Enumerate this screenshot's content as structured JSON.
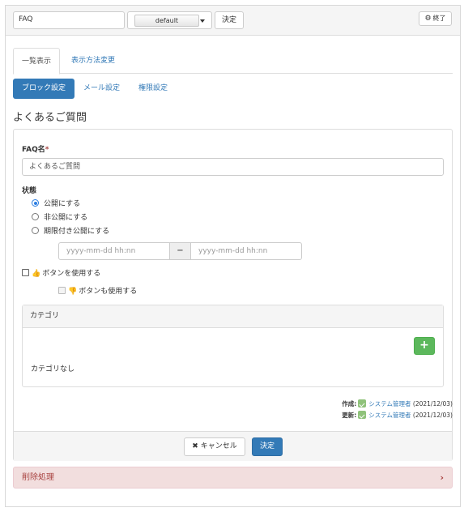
{
  "header": {
    "frame_title_value": "FAQ",
    "design_value": "default",
    "decide_label": "決定",
    "close_label": "終了"
  },
  "tabs": [
    {
      "label": "一覧表示",
      "active": true
    },
    {
      "label": "表示方法変更",
      "active": false
    }
  ],
  "pills": [
    {
      "label": "ブロック設定",
      "active": true
    },
    {
      "label": "メール設定",
      "active": false
    },
    {
      "label": "権限設定",
      "active": false
    }
  ],
  "page_title": "よくあるご質問",
  "form": {
    "faq_name_label": "FAQ名",
    "required_mark": "*",
    "faq_name_value": "よくあるご質問",
    "status_label": "状態",
    "status_options": [
      {
        "label": "公開にする",
        "checked": true
      },
      {
        "label": "非公開にする",
        "checked": false
      },
      {
        "label": "期限付き公開にする",
        "checked": false
      }
    ],
    "date_from_placeholder": "yyyy-mm-dd hh:nn",
    "date_separator": "−",
    "date_to_placeholder": "yyyy-mm-dd hh:nn",
    "like_label": "ボタンを使用する",
    "unlike_label": "ボタンも使用する",
    "category_heading": "カテゴリ",
    "add_symbol": "+",
    "no_category_text": "カテゴリなし"
  },
  "meta": {
    "created_label": "作成:",
    "created_user": "システム管理者",
    "created_date": "(2021/12/03)",
    "updated_label": "更新:",
    "updated_user": "システム管理者",
    "updated_date": "(2021/12/03)"
  },
  "footer": {
    "cancel_label": "キャンセル",
    "decide_label": "決定"
  },
  "delete_panel": {
    "label": "削除処理"
  },
  "colors": {
    "primary": "#337ab7",
    "success": "#5cb85c",
    "danger_bg": "#f2dede",
    "danger_text": "#a94442"
  }
}
